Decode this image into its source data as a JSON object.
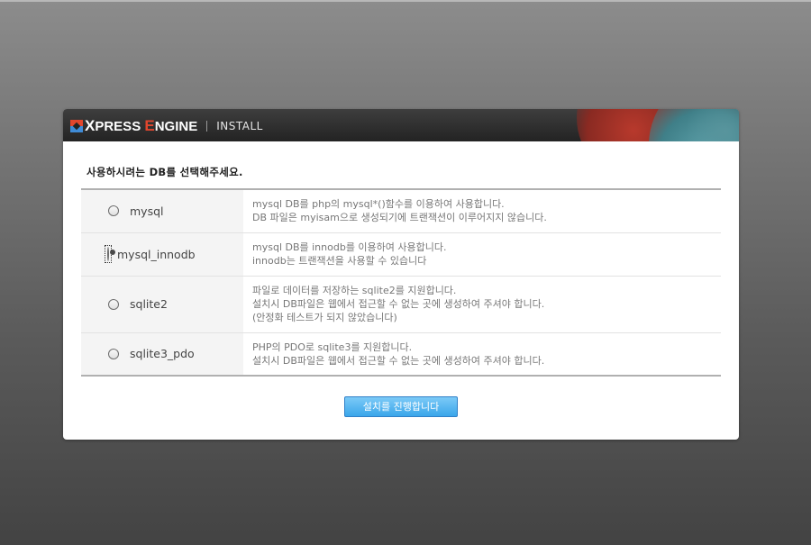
{
  "header": {
    "logo_x": "X",
    "logo_press": "PRESS ",
    "logo_e": "E",
    "logo_ngine": "NGINE",
    "install_label": "INSTALL"
  },
  "question": "사용하시려는 DB를 선택해주세요.",
  "options": [
    {
      "label": "mysql",
      "checked": false,
      "desc": [
        "mysql DB를 php의 mysql*()함수를 이용하여 사용합니다.",
        "DB 파일은 myisam으로 생성되기에 트랜잭션이 이루어지지 않습니다."
      ]
    },
    {
      "label": "mysql_innodb",
      "checked": true,
      "desc": [
        "mysql DB를 innodb를 이용하여 사용합니다.",
        "innodb는 트랜잭션을 사용할 수 있습니다"
      ]
    },
    {
      "label": "sqlite2",
      "checked": false,
      "desc": [
        "파일로 데이터를 저장하는 sqlite2를 지원합니다.",
        "설치시 DB파일은 웹에서 접근할 수 없는 곳에 생성하여 주셔야 합니다.",
        "(안정화 테스트가 되지 않았습니다)"
      ]
    },
    {
      "label": "sqlite3_pdo",
      "checked": false,
      "desc": [
        "PHP의 PDO로 sqlite3를 지원합니다.",
        "설치시 DB파일은 웹에서 접근할 수 없는 곳에 생성하여 주셔야 합니다."
      ]
    }
  ],
  "install_button": "설치를 진행합니다",
  "colors": {
    "button": "#3aa6ea",
    "logo_red": "#e2462d",
    "logo_blue": "#3f8bd6"
  }
}
